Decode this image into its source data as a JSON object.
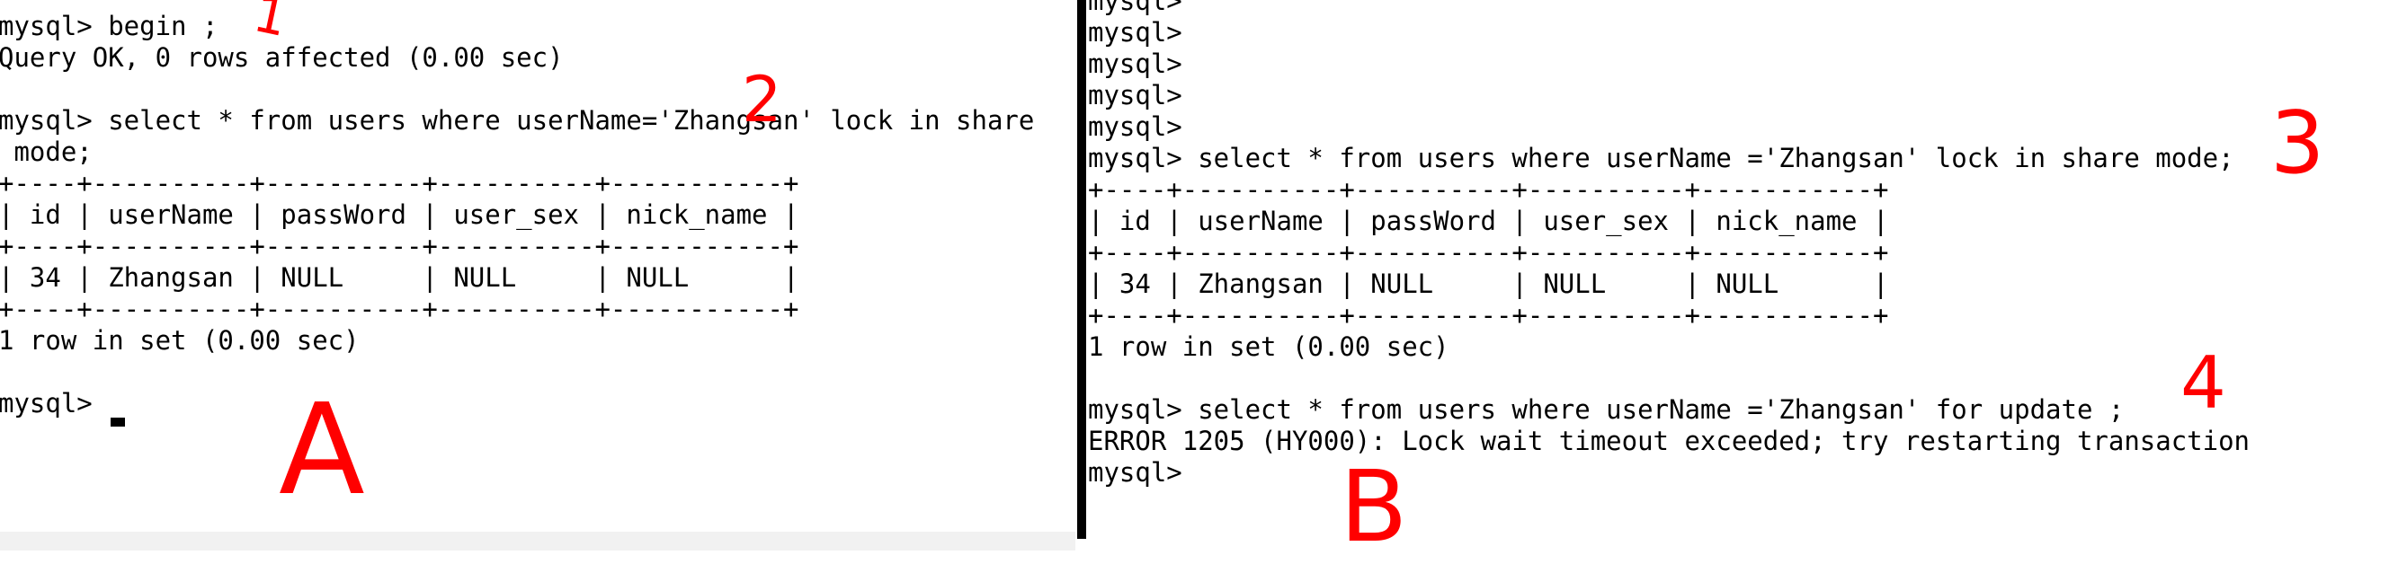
{
  "session_a": {
    "label": "A",
    "lines": [
      "mysql> begin ;",
      "Query OK, 0 rows affected (0.00 sec)",
      "",
      "mysql> select * from users where userName='Zhangsan' lock in share",
      " mode;",
      "+----+----------+----------+----------+-----------+",
      "| id | userName | passWord | user_sex | nick_name |",
      "+----+----------+----------+----------+-----------+",
      "| 34 | Zhangsan | NULL     | NULL     | NULL      |",
      "+----+----------+----------+----------+-----------+",
      "1 row in set (0.00 sec)",
      "",
      "mysql> "
    ]
  },
  "session_b": {
    "label": "B",
    "lines": [
      "mysql>",
      "mysql>",
      "mysql>",
      "mysql>",
      "mysql>",
      "mysql> select * from users where userName ='Zhangsan' lock in share mode;",
      "+----+----------+----------+----------+-----------+",
      "| id | userName | passWord | user_sex | nick_name |",
      "+----+----------+----------+----------+-----------+",
      "| 34 | Zhangsan | NULL     | NULL     | NULL      |",
      "+----+----------+----------+----------+-----------+",
      "1 row in set (0.00 sec)",
      "",
      "mysql> select * from users where userName ='Zhangsan' for update ;",
      "ERROR 1205 (HY000): Lock wait timeout exceeded; try restarting transaction",
      "mysql>"
    ]
  },
  "annotations": {
    "step1": "1",
    "step2": "2",
    "step3": "3",
    "step4": "4",
    "label_a": "A",
    "label_b": "B"
  },
  "colors": {
    "annotation": "#ff0000",
    "terminal_bg": "#ffffff",
    "terminal_text": "#000000"
  }
}
